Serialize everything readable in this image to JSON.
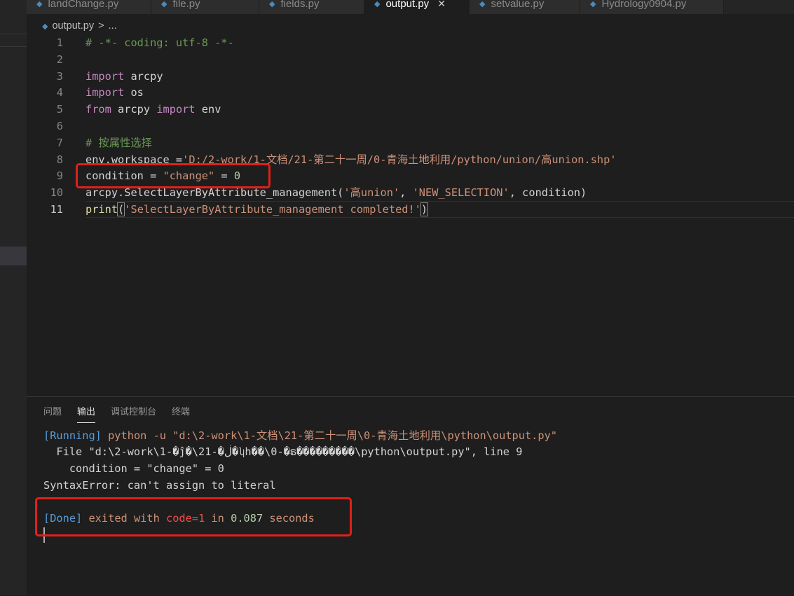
{
  "tabs": [
    {
      "label": "landChange.py",
      "active": false
    },
    {
      "label": "file.py",
      "active": false
    },
    {
      "label": "fields.py",
      "active": false
    },
    {
      "label": "output.py",
      "active": true
    },
    {
      "label": "setvalue.py",
      "active": false
    },
    {
      "label": "Hydrology0904.py",
      "active": false
    }
  ],
  "breadcrumb": {
    "file": "output.py",
    "sep": ">",
    "more": "..."
  },
  "code": {
    "lines": [
      {
        "n": "1",
        "tokens": [
          {
            "t": "# -*- coding: utf-8 -*-",
            "c": "cmt"
          }
        ]
      },
      {
        "n": "2",
        "tokens": []
      },
      {
        "n": "3",
        "tokens": [
          {
            "t": "import",
            "c": "kw"
          },
          {
            "t": " arcpy",
            "c": "id"
          }
        ]
      },
      {
        "n": "4",
        "tokens": [
          {
            "t": "import",
            "c": "kw"
          },
          {
            "t": " os",
            "c": "id"
          }
        ]
      },
      {
        "n": "5",
        "tokens": [
          {
            "t": "from",
            "c": "kw"
          },
          {
            "t": " arcpy ",
            "c": "id"
          },
          {
            "t": "import",
            "c": "kw"
          },
          {
            "t": " env",
            "c": "id"
          }
        ]
      },
      {
        "n": "6",
        "tokens": []
      },
      {
        "n": "7",
        "tokens": [
          {
            "t": "# 按属性选择",
            "c": "cmt"
          }
        ]
      },
      {
        "n": "8",
        "tokens": [
          {
            "t": "env.workspace =",
            "c": "id"
          },
          {
            "t": "'D:/2-work/1-文档/21-第二十一周/0-青海土地利用/python/union/高union.shp'",
            "c": "str"
          }
        ]
      },
      {
        "n": "9",
        "tokens": [
          {
            "t": "condition = ",
            "c": "id"
          },
          {
            "t": "\"change\"",
            "c": "str"
          },
          {
            "t": " = ",
            "c": "id"
          },
          {
            "t": "0",
            "c": "num"
          }
        ]
      },
      {
        "n": "10",
        "tokens": [
          {
            "t": "arcpy.SelectLayerByAttribute_management(",
            "c": "id"
          },
          {
            "t": "'高union'",
            "c": "str"
          },
          {
            "t": ", ",
            "c": "id"
          },
          {
            "t": "'NEW_SELECTION'",
            "c": "str"
          },
          {
            "t": ", condition)",
            "c": "id"
          }
        ]
      },
      {
        "n": "11",
        "tokens": [
          {
            "t": "print",
            "c": "fn"
          },
          {
            "t": "(",
            "c": "id brk"
          },
          {
            "t": "'SelectLayerByAttribute_management completed!'",
            "c": "str"
          },
          {
            "t": ")",
            "c": "id brk"
          }
        ]
      }
    ]
  },
  "panel": {
    "tabs": [
      {
        "label": "问题",
        "active": false
      },
      {
        "label": "输出",
        "active": true
      },
      {
        "label": "调试控制台",
        "active": false
      },
      {
        "label": "终端",
        "active": false
      }
    ],
    "output": [
      [
        {
          "t": "[Running]",
          "c": "blue"
        },
        {
          "t": " python -u \"d:\\2-work\\1-文档\\21-第二十一周\\0-青海土地利用\\python\\output.py\"",
          "c": "orange"
        }
      ],
      [
        {
          "t": "  File \"d:\\2-work\\1-�ĵ�\\21-�ڶ�ʮһ��\\0-�ຣ���������\\python\\output.py\", line 9",
          "c": "white"
        }
      ],
      [
        {
          "t": "    condition = \"change\" = 0",
          "c": "white"
        }
      ],
      [
        {
          "t": "SyntaxError: can't assign to literal",
          "c": "white"
        }
      ],
      [],
      [
        {
          "t": "[Done]",
          "c": "blue"
        },
        {
          "t": " exited with ",
          "c": "orange"
        },
        {
          "t": "code=1",
          "c": "red"
        },
        {
          "t": " in ",
          "c": "orange"
        },
        {
          "t": "0.087",
          "c": "green"
        },
        {
          "t": " seconds",
          "c": "orange"
        }
      ]
    ]
  }
}
